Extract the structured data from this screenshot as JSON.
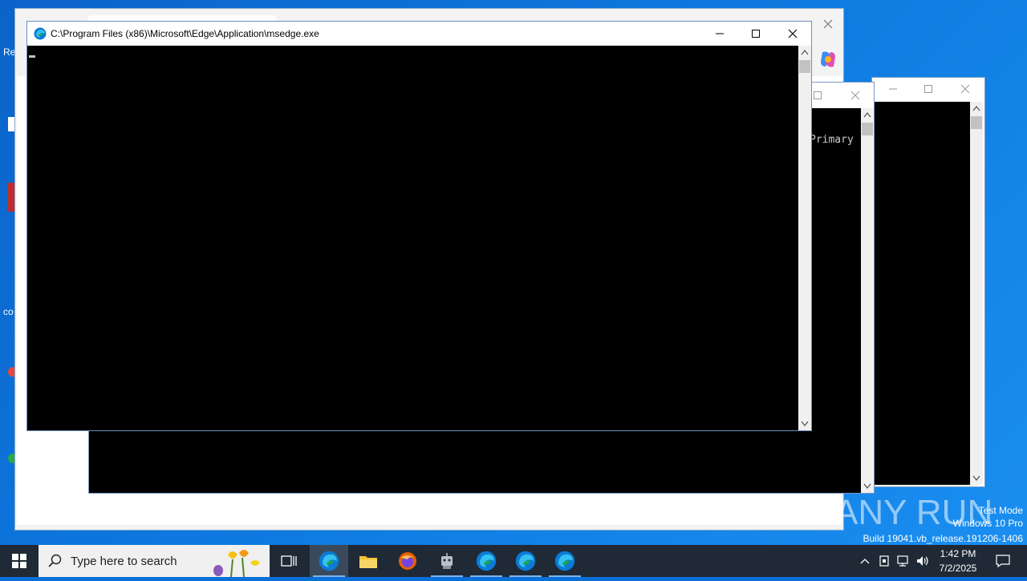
{
  "main_window": {
    "title": "C:\\Program Files (x86)\\Microsoft\\Edge\\Application\\msedge.exe"
  },
  "console_2": {
    "visible_text": "Primary"
  },
  "desktop": {
    "label_1": "Re",
    "label_2": "co"
  },
  "watermark": {
    "line1": "Test Mode",
    "line2": "Windows 10 Pro",
    "line3": "Build 19041.vb_release.191206-1406",
    "brand": "ANY RUN"
  },
  "taskbar": {
    "search_placeholder": "Type here to search",
    "time": "1:42 PM",
    "date": "7/2/2025",
    "apps": [
      "task-view",
      "edge",
      "file-explorer",
      "firefox",
      "app-robot",
      "edge",
      "edge",
      "edge"
    ]
  },
  "colors": {
    "desktop": "#0d78df",
    "taskbar": "#1f2a36",
    "console_bg": "#000000"
  }
}
